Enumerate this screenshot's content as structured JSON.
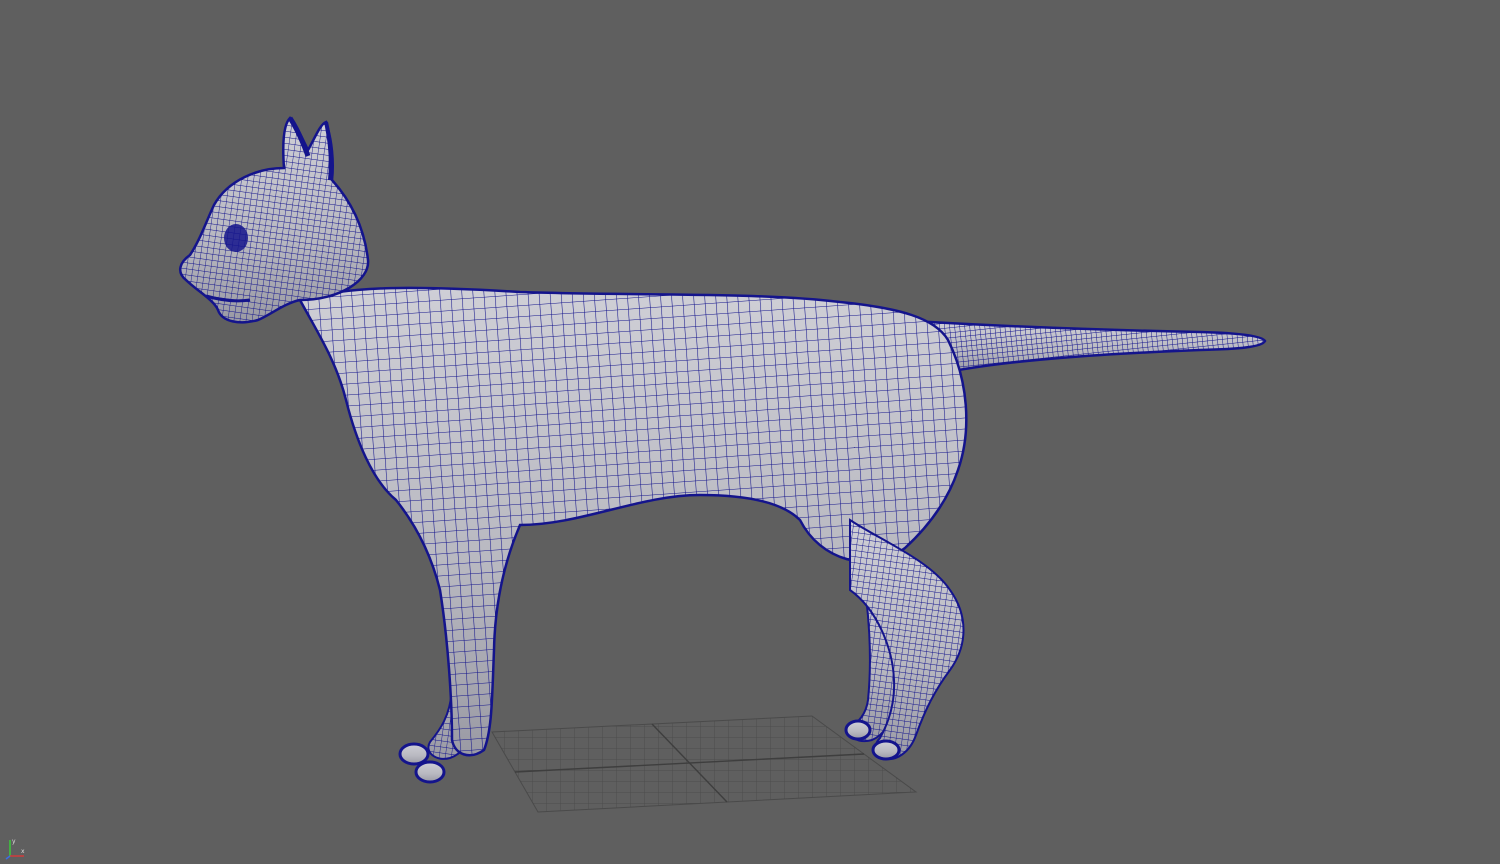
{
  "viewport": {
    "background": "#5f5f5f",
    "object": "cat",
    "wire_color": "#14148c",
    "surface_color": "#bdbdc4",
    "ground_grid": true,
    "axis_gizmo": {
      "x_label": "x",
      "y_label": "y",
      "x_color": "#d23c3c",
      "y_color": "#3cc83c",
      "z_color": "#3c6ee6"
    }
  }
}
